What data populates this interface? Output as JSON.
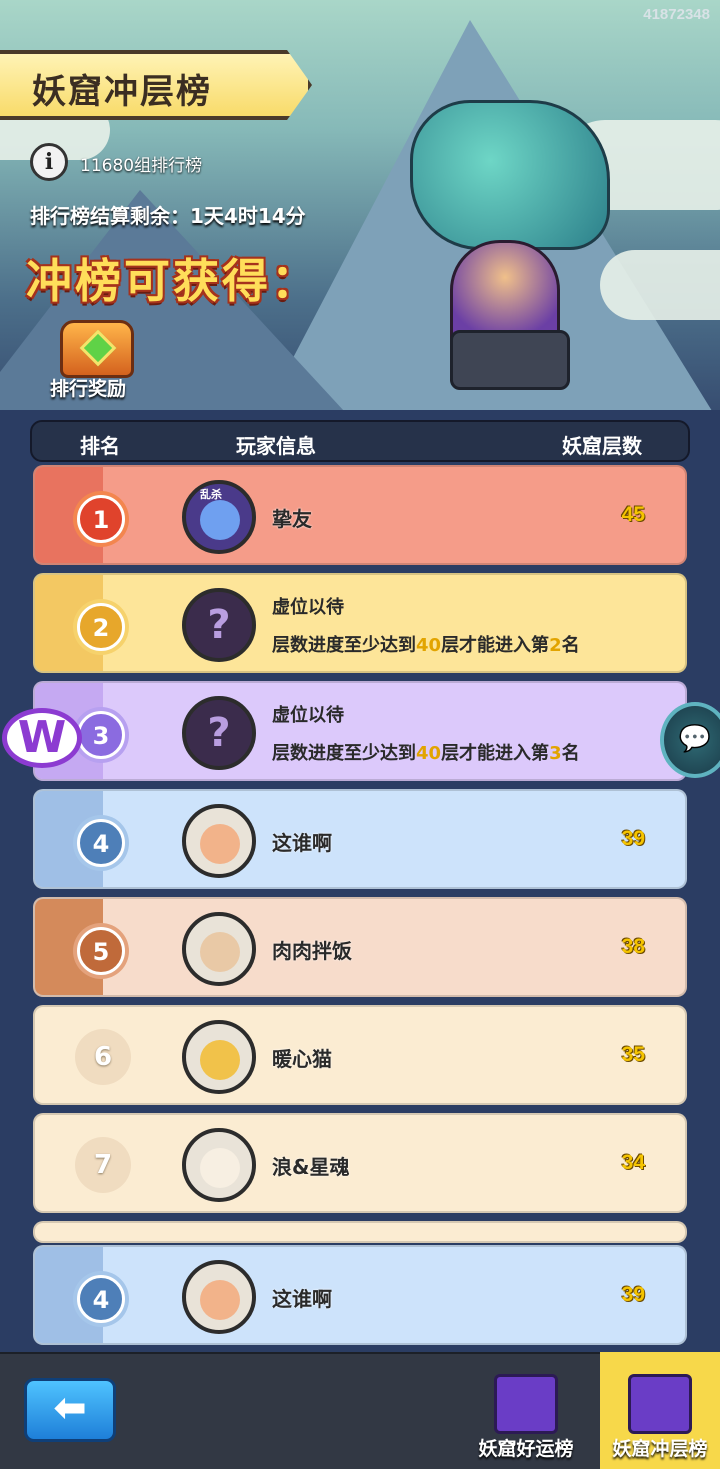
{
  "build_id": "41872348",
  "title": "妖窟冲层榜",
  "info": {
    "group_text": "11680组排行榜",
    "countdown": "排行榜结算剩余：1天4时14分"
  },
  "reward": {
    "heading": "冲榜可获得：",
    "chest_label": "排行奖励"
  },
  "table": {
    "headers": {
      "rank": "排名",
      "player": "玩家信息",
      "floors": "妖窟层数"
    },
    "rows": [
      {
        "rank": "1",
        "name": "挚友",
        "score": "45"
      },
      {
        "rank": "2",
        "vacant_title": "虚位以待",
        "note_prefix": "层数进度至少达到",
        "note_floor": "40",
        "note_mid": "层才能进入第",
        "note_rank": "2",
        "note_suffix": "名"
      },
      {
        "rank": "3",
        "vacant_title": "虚位以待",
        "note_prefix": "层数进度至少达到",
        "note_floor": "40",
        "note_mid": "层才能进入第",
        "note_rank": "3",
        "note_suffix": "名"
      },
      {
        "rank": "4",
        "name": "这谁啊",
        "score": "39"
      },
      {
        "rank": "5",
        "name": "肉肉拌饭",
        "score": "38"
      },
      {
        "rank": "6",
        "name": "暖心猫",
        "score": "35"
      },
      {
        "rank": "7",
        "name": "浪&星魂",
        "score": "34"
      }
    ],
    "my_row": {
      "rank": "4",
      "name": "这谁啊",
      "score": "39"
    },
    "avatar_badge": "乱杀",
    "unknown_glyph": "?"
  },
  "bottom": {
    "back_icon": "arrow-left-icon",
    "tab_luck": "妖窟好运榜",
    "tab_floor": "妖窟冲层榜"
  },
  "side": {
    "left_logo": "W",
    "chat_glyph": "💬"
  },
  "colors": {
    "rank1": "#f59c89",
    "rank2": "#fde599",
    "rank3": "#dcc9fb",
    "rank4": "#cde3fb",
    "rank5": "#f7dccb",
    "default": "#fbecd2",
    "score": "#f5c400",
    "active_tab": "#f7d84a"
  }
}
